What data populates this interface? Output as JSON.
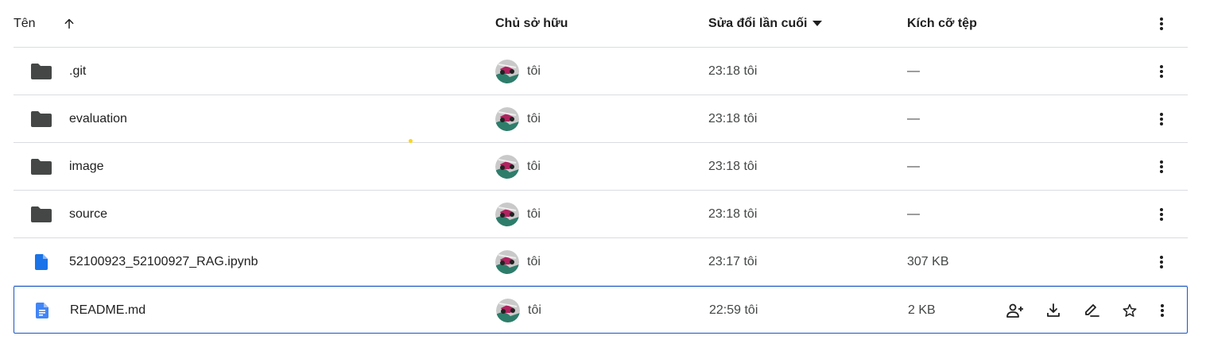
{
  "header": {
    "name": "Tên",
    "owner": "Chủ sở hữu",
    "modified": "Sửa đổi lần cuối",
    "size": "Kích cỡ tệp"
  },
  "rows": [
    {
      "name": ".git",
      "type": "folder",
      "owner": "tôi",
      "modified": "23:18 tôi",
      "size": "—"
    },
    {
      "name": "evaluation",
      "type": "folder",
      "owner": "tôi",
      "modified": "23:18 tôi",
      "size": "—"
    },
    {
      "name": "image",
      "type": "folder",
      "owner": "tôi",
      "modified": "23:18 tôi",
      "size": "—"
    },
    {
      "name": "source",
      "type": "folder",
      "owner": "tôi",
      "modified": "23:18 tôi",
      "size": "—"
    },
    {
      "name": "52100923_52100927_RAG.ipynb",
      "type": "file",
      "owner": "tôi",
      "modified": "23:17 tôi",
      "size": "307 KB"
    },
    {
      "name": "README.md",
      "type": "doc",
      "owner": "tôi",
      "modified": "22:59 tôi",
      "size": "2 KB"
    }
  ],
  "row_actions": [
    "share-icon",
    "download-icon",
    "rename-icon",
    "star-icon"
  ],
  "colors": {
    "folder": "#444746",
    "file_blue": "#1a73e8",
    "selected_border": "#1a56c4",
    "divider": "#dadce0"
  }
}
